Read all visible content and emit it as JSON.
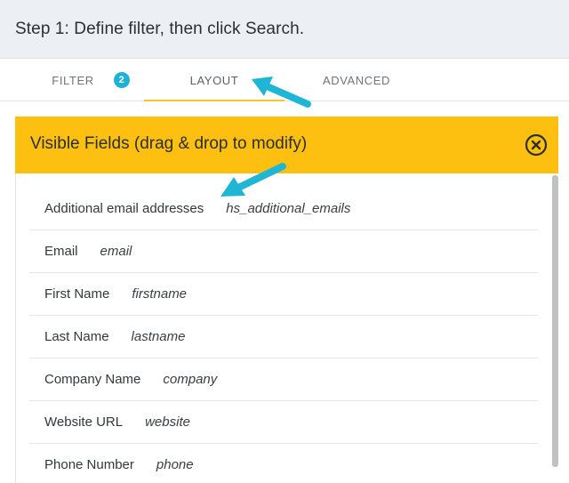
{
  "step_header": {
    "title": "Step 1: Define filter, then click Search."
  },
  "tabs": [
    {
      "label": "FILTER",
      "badge": "2",
      "active": false
    },
    {
      "label": "LAYOUT",
      "active": true
    },
    {
      "label": "ADVANCED",
      "active": false
    }
  ],
  "panel": {
    "title": "Visible Fields (drag & drop to modify)",
    "close_icon": "circle-x-icon",
    "fields": [
      {
        "label": "Additional email addresses",
        "key": "hs_additional_emails"
      },
      {
        "label": "Email",
        "key": "email"
      },
      {
        "label": "First Name",
        "key": "firstname"
      },
      {
        "label": "Last Name",
        "key": "lastname"
      },
      {
        "label": "Company Name",
        "key": "company"
      },
      {
        "label": "Website URL",
        "key": "website"
      },
      {
        "label": "Phone Number",
        "key": "phone"
      }
    ]
  },
  "colors": {
    "header_bg": "#eceff3",
    "panel_header_bg": "#fdbf10",
    "badge_bg": "#21b1d6",
    "active_tab_underline": "#f4c62a",
    "annotation_arrow": "#1fb6d6"
  },
  "annotations": [
    "arrow-pointing-to-layout-tab",
    "arrow-pointing-to-first-field"
  ]
}
